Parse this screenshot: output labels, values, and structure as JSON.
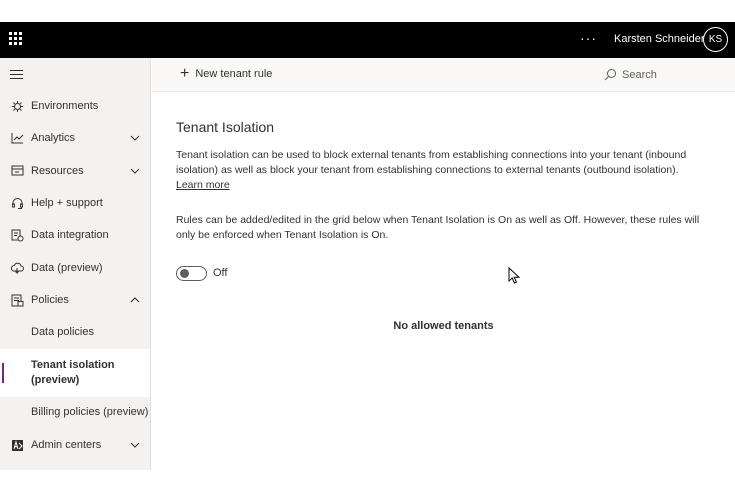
{
  "header": {
    "more_label": "···",
    "user_name": "Karsten Schneider",
    "avatar_initials": "KS"
  },
  "sidebar": {
    "items": [
      {
        "label": "Environments",
        "icon": "environments-icon"
      },
      {
        "label": "Analytics",
        "icon": "analytics-icon",
        "expandable": true
      },
      {
        "label": "Resources",
        "icon": "resources-icon",
        "expandable": true
      },
      {
        "label": "Help + support",
        "icon": "headset-icon"
      },
      {
        "label": "Data integration",
        "icon": "data-integration-icon"
      },
      {
        "label": "Data (preview)",
        "icon": "cloud-data-icon"
      },
      {
        "label": "Policies",
        "icon": "policies-icon",
        "expanded": true
      },
      {
        "label": "Data policies"
      },
      {
        "label": "Tenant isolation (preview)",
        "active": true
      },
      {
        "label": "Billing policies (preview)"
      },
      {
        "label": "Admin centers",
        "icon": "admin-centers-icon",
        "expandable": true
      }
    ]
  },
  "commandbar": {
    "new_rule_label": "New tenant rule",
    "search_placeholder": "Search"
  },
  "main": {
    "title": "Tenant Isolation",
    "description": "Tenant isolation can be used to block external tenants from establishing connections into your tenant (inbound isolation) as well as block your tenant from establishing connections to external tenants (outbound isolation).",
    "learn_more": "Learn more",
    "rules_note": "Rules can be added/edited in the grid below when Tenant Isolation is On as well as Off. However, these rules will only be enforced when Tenant Isolation is On.",
    "toggle_label": "Off",
    "toggle_on": false,
    "empty_state": "No allowed tenants"
  },
  "colors": {
    "topbar": "#000000",
    "accent": "#742774",
    "sidebar_bg": "#f3f2f1"
  }
}
